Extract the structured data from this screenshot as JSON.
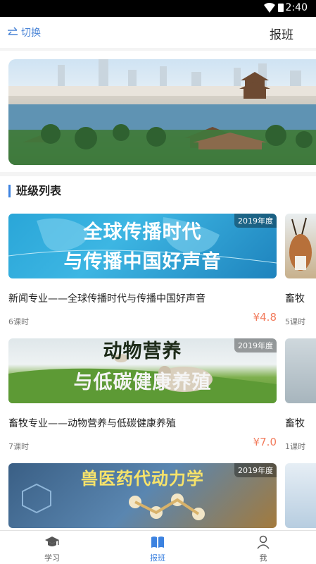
{
  "status_bar": {
    "time": "2:40"
  },
  "header": {
    "switch_label": "切换",
    "title": "报班"
  },
  "section": {
    "title": "班级列表"
  },
  "courses": [
    {
      "thumb_line1": "全球传播时代",
      "thumb_line2": "与传播中国好声音",
      "year": "2019年度",
      "name": "新闻专业——全球传播时代与传播中国好声音",
      "hours": "6课时",
      "price": "¥4.8"
    },
    {
      "thumb_line1": "动物营养",
      "thumb_line2": "与低碳健康养殖",
      "year": "2019年度",
      "name": "畜牧专业——动物营养与低碳健康养殖",
      "hours": "7课时",
      "price": "¥7.0"
    },
    {
      "thumb_line1": "兽医药代动力学",
      "thumb_line2": "",
      "year": "2019年度"
    }
  ],
  "side_courses": [
    {
      "name": "畜牧",
      "hours": "5课时"
    },
    {
      "name": "畜牧",
      "hours": "1课时"
    }
  ],
  "tabs": [
    {
      "label": "学习"
    },
    {
      "label": "报班"
    },
    {
      "label": "我"
    }
  ],
  "colors": {
    "accent": "#3c82e0",
    "price": "#f27b5c"
  },
  "icons": {
    "switch": "swap-arrows-icon",
    "study": "graduation-cap-icon",
    "enroll": "open-book-icon",
    "me": "person-icon"
  }
}
